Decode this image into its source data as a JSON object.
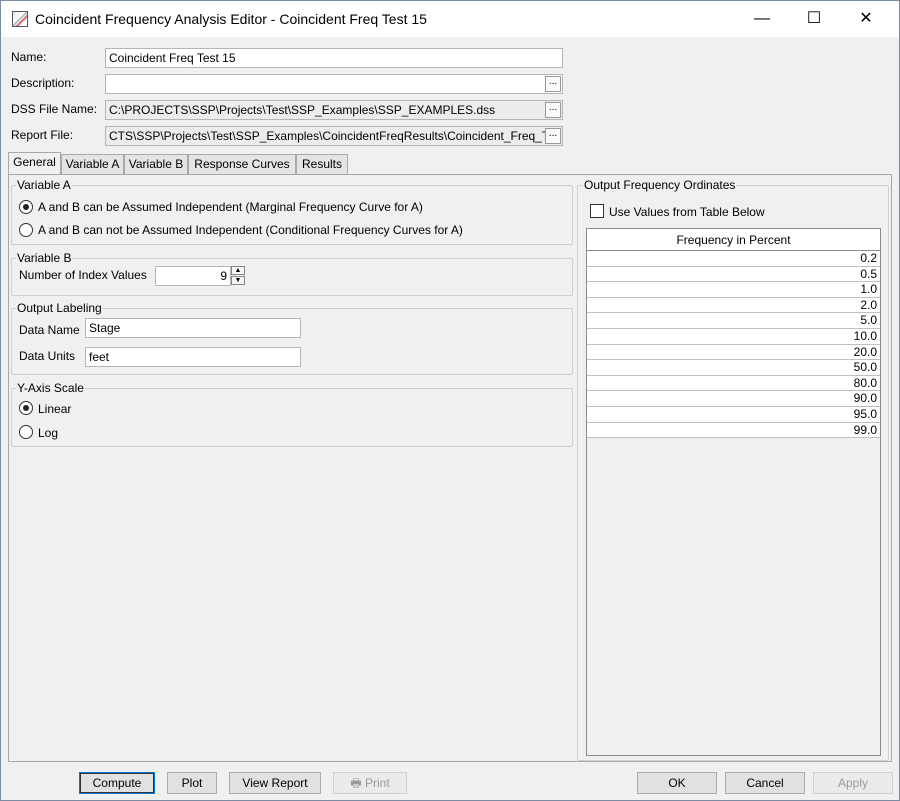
{
  "window": {
    "title": "Coincident Frequency Analysis Editor - Coincident Freq Test 15",
    "min": "—",
    "max": "☐",
    "close": "✕"
  },
  "form": {
    "name_label": "Name:",
    "name_value": "Coincident Freq Test 15",
    "description_label": "Description:",
    "description_value": "",
    "dss_label": "DSS File Name:",
    "dss_value": "C:\\PROJECTS\\SSP\\Projects\\Test\\SSP_Examples\\SSP_EXAMPLES.dss",
    "report_label": "Report File:",
    "report_value": "CTS\\SSP\\Projects\\Test\\SSP_Examples\\CoincidentFreqResults\\Coincident_Freq_Te",
    "browse": "..."
  },
  "tabs": [
    "General",
    "Variable A",
    "Variable B",
    "Response Curves",
    "Results"
  ],
  "general": {
    "variable_a": {
      "title": "Variable A",
      "opt1": "A and B can be Assumed Independent (Marginal Frequency Curve for A)",
      "opt2": "A and B can not be Assumed Independent (Conditional Frequency Curves for A)"
    },
    "variable_b": {
      "title": "Variable B",
      "index_label": "Number of Index Values",
      "index_value": "9",
      "up": "▲",
      "down": "▼"
    },
    "output_labeling": {
      "title": "Output Labeling",
      "data_name_label": "Data Name",
      "data_name_value": "Stage",
      "data_units_label": "Data Units",
      "data_units_value": "feet"
    },
    "y_axis": {
      "title": "Y-Axis Scale",
      "linear": "Linear",
      "log": "Log"
    },
    "ordinates": {
      "title": "Output Frequency Ordinates",
      "use_table_label": "Use Values from Table Below",
      "column_header": "Frequency in Percent",
      "rows": [
        "0.2",
        "0.5",
        "1.0",
        "2.0",
        "5.0",
        "10.0",
        "20.0",
        "50.0",
        "80.0",
        "90.0",
        "95.0",
        "99.0"
      ]
    }
  },
  "buttons": {
    "compute": "Compute",
    "plot": "Plot",
    "view_report": "View Report",
    "print": "Print",
    "print_icon": "🖶",
    "ok": "OK",
    "cancel": "Cancel",
    "apply": "Apply"
  }
}
